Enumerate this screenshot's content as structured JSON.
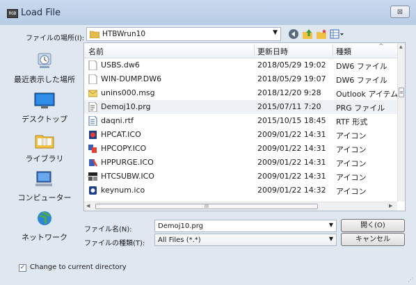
{
  "window": {
    "title": "Load File",
    "app_icon_text": "RGB",
    "close_glyph": "⊠"
  },
  "location": {
    "label": "ファイルの場所(I):",
    "value": "HTBWrun10"
  },
  "toolbar": {
    "back": "◀",
    "up": "⬆",
    "new_folder": "✚",
    "view": "▦▾"
  },
  "places": [
    {
      "label": "最近表示した場所",
      "icon": "recent-places-icon"
    },
    {
      "label": "デスクトップ",
      "icon": "desktop-icon"
    },
    {
      "label": "ライブラリ",
      "icon": "libraries-icon"
    },
    {
      "label": "コンピューター",
      "icon": "computer-icon"
    },
    {
      "label": "ネットワーク",
      "icon": "network-icon"
    }
  ],
  "columns": {
    "name": "名前",
    "date": "更新日時",
    "type": "種類"
  },
  "files": [
    {
      "name": "USBS.dw6",
      "date": "2018/05/29 19:02",
      "type": "DW6 ファイル",
      "icon": "blank"
    },
    {
      "name": "WIN-DUMP.DW6",
      "date": "2018/05/29 19:07",
      "type": "DW6 ファイル",
      "icon": "blank"
    },
    {
      "name": "unins000.msg",
      "date": "2018/12/20 9:28",
      "type": "Outlook アイテム",
      "icon": "mail"
    },
    {
      "name": "Demoj10.prg",
      "date": "2015/07/11 7:20",
      "type": "PRG ファイル",
      "icon": "prg"
    },
    {
      "name": "daqni.rtf",
      "date": "2015/10/15 18:45",
      "type": "RTF 形式",
      "icon": "rtf"
    },
    {
      "name": "HPCAT.ICO",
      "date": "2009/01/22 14:31",
      "type": "アイコン",
      "icon": "ico-cat"
    },
    {
      "name": "HPCOPY.ICO",
      "date": "2009/01/22 14:31",
      "type": "アイコン",
      "icon": "ico-copy"
    },
    {
      "name": "HPPURGE.ICO",
      "date": "2009/01/22 14:31",
      "type": "アイコン",
      "icon": "ico-purge"
    },
    {
      "name": "HTCSUBW.ICO",
      "date": "2009/01/22 14:31",
      "type": "アイコン",
      "icon": "ico-sub"
    },
    {
      "name": "keynum.ico",
      "date": "2009/01/22 14:32",
      "type": "アイコン",
      "icon": "ico-key"
    }
  ],
  "selected_file": "Demoj10.prg",
  "filename": {
    "label": "ファイル名(N):",
    "value": "Demoj10.prg"
  },
  "filetype": {
    "label": "ファイルの種類(T):",
    "value": "All Files (*.*)"
  },
  "buttons": {
    "open": "開く(O)",
    "cancel": "キャンセル"
  },
  "checkbox": {
    "label": "Change to current directory",
    "checked": true,
    "mark": "✓"
  },
  "scroll": {
    "vthumb_glyph": "≡",
    "hthumb_glyph": "III"
  }
}
